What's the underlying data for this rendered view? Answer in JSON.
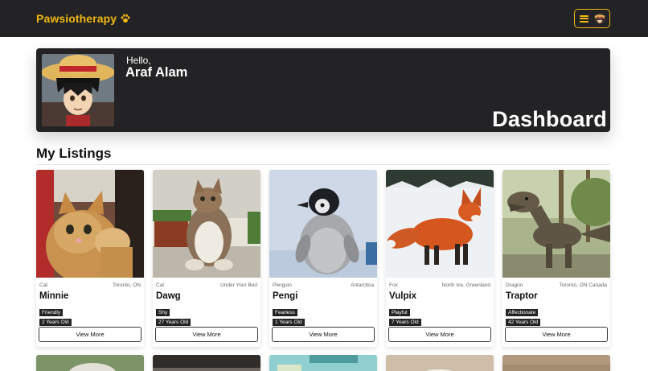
{
  "navbar": {
    "brand": "Pawsiotherapy",
    "brand_color": "#f2b712",
    "background": "#232325"
  },
  "hero": {
    "greeting": "Hello,",
    "user_name": "Araf Alam",
    "page_title": "Dashboard"
  },
  "listings": {
    "title": "My Listings",
    "button_label": "View More",
    "items": [
      {
        "species": "Cat",
        "location": "Toronto, ON",
        "name": "Minnie",
        "trait": "Friendly",
        "age": "2 Years Old"
      },
      {
        "species": "Cat",
        "location": "Under Your Bed",
        "name": "Dawg",
        "trait": "Shy",
        "age": "27 Years Old"
      },
      {
        "species": "Penguin",
        "location": "Antarctica",
        "name": "Pengi",
        "trait": "Fearless",
        "age": "1 Years Old"
      },
      {
        "species": "Fox",
        "location": "North Ice, Greenland",
        "name": "Vulpix",
        "trait": "Playful",
        "age": "7 Years Old"
      },
      {
        "species": "Dragon",
        "location": "Toronto, ON Canada",
        "name": "Traptor",
        "trait": "Affectionate",
        "age": "42 Years Old"
      }
    ]
  }
}
